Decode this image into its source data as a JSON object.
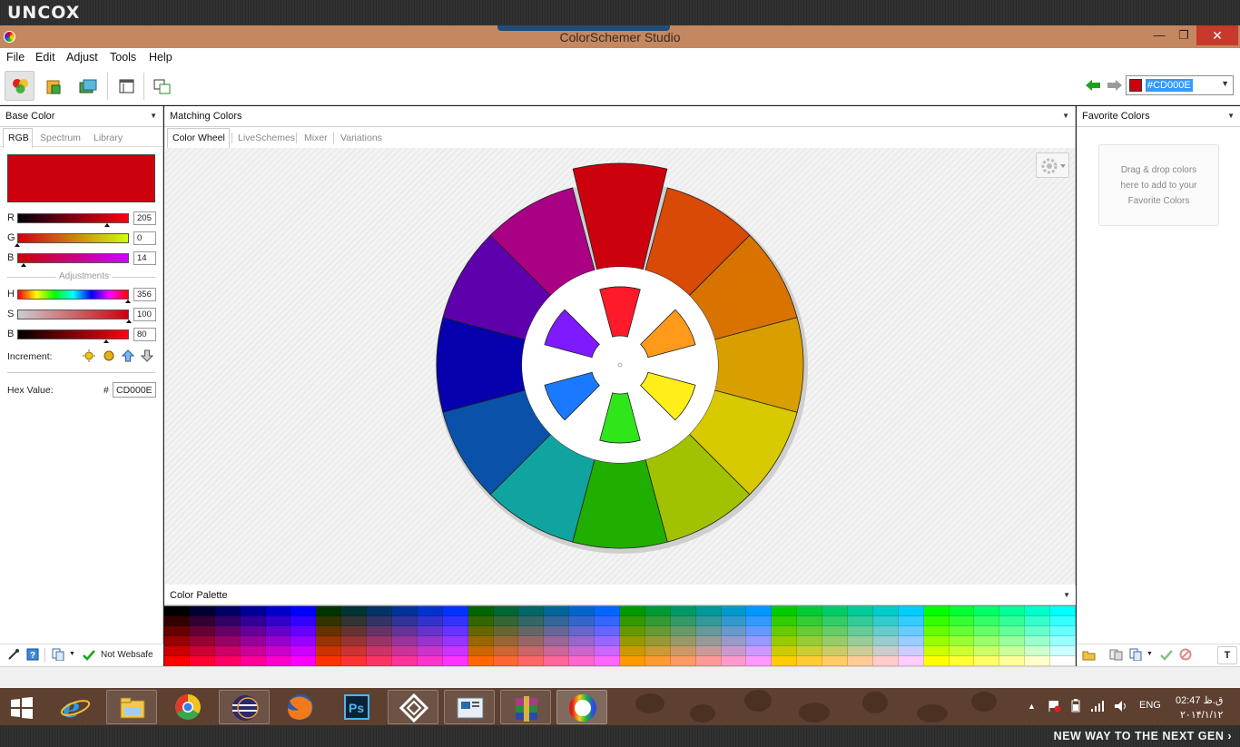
{
  "brand": {
    "logo_text": "UNCOX",
    "slogan": "NEW WAY TO THE NEXT GEN ›"
  },
  "window": {
    "title": "ColorSchemer Studio",
    "minimize": "—",
    "maximize": "❐",
    "close": "✕"
  },
  "menu": [
    "File",
    "Edit",
    "Adjust",
    "Tools",
    "Help"
  ],
  "toolbar": {
    "buttons": [
      "color-wheel-tool-icon",
      "export-tool-icon",
      "gallery-tool-icon",
      "palette-view-icon",
      "compare-tool-icon"
    ],
    "current_hex": "#CD000E",
    "nav_colors": {
      "back": "#1aa31a",
      "forward": "#9a9a9a"
    }
  },
  "left_panel": {
    "title": "Base Color",
    "tabs": [
      "RGB",
      "Spectrum",
      "Library"
    ],
    "base_color": "#CD000E",
    "sliders": [
      {
        "label": "R",
        "value": "205",
        "level": 0.804,
        "gradient": "linear-gradient(90deg,#00000e,#ff000e)"
      },
      {
        "label": "G",
        "value": "0",
        "level": 0.0,
        "gradient": "linear-gradient(90deg,#cd000e,#cdff0e)"
      },
      {
        "label": "B",
        "value": "14",
        "level": 0.055,
        "gradient": "linear-gradient(90deg,#cd0000,#cd00ff)"
      }
    ],
    "adjustments_label": "Adjustments",
    "hsb_sliders": [
      {
        "label": "H",
        "value": "356",
        "level": 0.989,
        "gradient": "linear-gradient(90deg,#f00,#ff0,#0f0,#0ff,#00f,#f0f,#f00)"
      },
      {
        "label": "S",
        "value": "100",
        "level": 1.0,
        "gradient": "linear-gradient(90deg,#cdcdcd,#cd000e)"
      },
      {
        "label": "B",
        "value": "80",
        "level": 0.8,
        "gradient": "linear-gradient(90deg,#000,#ff0011)"
      }
    ],
    "increment_label": "Increment:",
    "increment_icons": [
      "lighten-icon",
      "darken-icon",
      "up-arrow-icon",
      "down-arrow-icon"
    ],
    "hex_label": "Hex Value:",
    "hex_hash": "#",
    "hex_value": "CD000E",
    "bottom": {
      "websafe_label": "Not Websafe"
    }
  },
  "center_panel": {
    "title": "Matching Colors",
    "tabs": [
      "Color Wheel",
      "LiveSchemes",
      "Mixer",
      "Variations"
    ],
    "wheel": {
      "outer_colors": [
        "#cd000e",
        "#d84a05",
        "#d87300",
        "#d99f00",
        "#d8c900",
        "#a1c200",
        "#20ae00",
        "#10a39f",
        "#0a52a9",
        "#0600ad",
        "#5f00ad",
        "#aa0083"
      ],
      "inner_colors": [
        "#ff1a2a",
        "#ff9a1a",
        "#ffee1a",
        "#2ee61a",
        "#1a7aff",
        "#7f1aff"
      ]
    }
  },
  "palette": {
    "title": "Color Palette"
  },
  "right_panel": {
    "title": "Favorite Colors",
    "hint_lines": [
      "Drag & drop colors",
      "here to add to your",
      "Favorite Colors"
    ]
  },
  "taskbar": {
    "apps": [
      "windows-start-icon",
      "internet-explorer-icon",
      "file-explorer-icon",
      "chrome-icon",
      "eclipse-icon",
      "firefox-icon",
      "photoshop-icon",
      "app-icon",
      "presentation-icon",
      "winrar-icon",
      "colorschemer-icon"
    ],
    "ps_label": "Ps",
    "lang": "ENG",
    "time": "02:47 ق.ظ",
    "date": "۲۰۱۴/۱/۱۲",
    "tray_up": "▲"
  }
}
